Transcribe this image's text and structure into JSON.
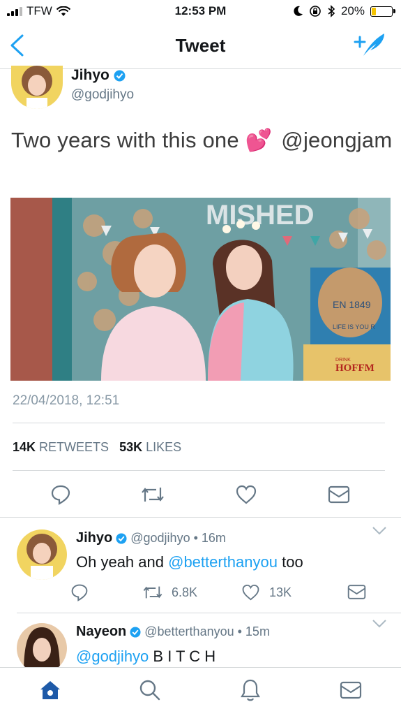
{
  "status_bar": {
    "carrier": "TFW",
    "time": "12:53 PM",
    "battery": "20%"
  },
  "nav": {
    "title": "Tweet"
  },
  "tweet": {
    "name": "Jihyo",
    "handle": "@godjihyo",
    "text": "Two years with this one",
    "emoji": "💕",
    "mention": "@jeongjam",
    "date": "22/04/2018, 12:51",
    "retweet_count": "14K",
    "retweet_label": "RETWEETS",
    "like_count": "53K",
    "like_label": "LIKES",
    "photo": {
      "sign_year": "EN 1849",
      "sign_text": "LIFE IS YOU R",
      "crate_text": "HOFFM",
      "crate_small": "DRINK",
      "banner_text": "MISHED"
    }
  },
  "replies": [
    {
      "name": "Jihyo",
      "handle": "@godjihyo",
      "time": "16m",
      "text_before": "Oh yeah and",
      "mention": "@betterthanyou",
      "text_after": "too",
      "retweets": "6.8K",
      "likes": "13K"
    },
    {
      "name": "Nayeon",
      "handle": "@betterthanyou",
      "time": "15m",
      "mention": "@godjihyo",
      "text_after": "B I T C H"
    }
  ],
  "colors": {
    "accent": "#1da1f2",
    "text": "#14171a",
    "muted": "#657786",
    "divider": "#d6d9db"
  },
  "icons": [
    "signal-icon",
    "wifi-icon",
    "moon-icon",
    "lock-rotation-icon",
    "bluetooth-icon",
    "battery-icon",
    "back-icon",
    "compose-icon",
    "verified-icon",
    "reply-icon",
    "retweet-icon",
    "like-icon",
    "dm-icon",
    "chevron-down-icon",
    "home-icon",
    "search-icon",
    "notifications-icon",
    "messages-icon"
  ]
}
